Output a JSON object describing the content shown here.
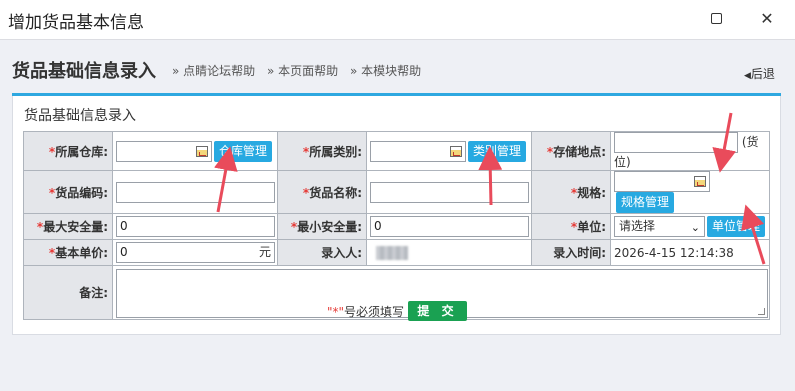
{
  "window": {
    "title": "增加货品基本信息"
  },
  "header": {
    "title": "货品基础信息录入",
    "help_links": [
      "» 点睛论坛帮助",
      "» 本页面帮助",
      "» 本模块帮助"
    ],
    "back_label": "后退"
  },
  "form": {
    "section_title": "货品基础信息录入",
    "required_mark": "*",
    "labels": {
      "warehouse": "所属仓库:",
      "category": "所属类别:",
      "location": "存储地点:",
      "code": "货品编码:",
      "name": "货品名称:",
      "spec": "规格:",
      "max_stock": "最大安全量:",
      "min_stock": "最小安全量:",
      "unit": "单位:",
      "unit_price": "基本单价:",
      "entered_by": "录入人:",
      "entry_time": "录入时间:",
      "remarks": "备注:"
    },
    "values": {
      "warehouse": "",
      "category": "",
      "location": "",
      "location_suffix": "(货位)",
      "code": "",
      "name": "",
      "spec": "",
      "max_stock": "0",
      "min_stock": "0",
      "unit_selected": "请选择",
      "unit_price": "0",
      "unit_price_suffix": "元",
      "entry_time": "2026-4-15 12:14:38",
      "remarks": ""
    },
    "buttons": {
      "warehouse_manage": "仓库管理",
      "category_manage": "类别管理",
      "spec_manage": "规格管理",
      "unit_manage": "单位管理"
    }
  },
  "footer": {
    "hint_star": "\"*\"",
    "hint_text": "号必须填写",
    "submit_label": "提 交"
  },
  "colors": {
    "accent_blue": "#27a9e1",
    "header_line": "#2ea8e0",
    "required_red": "#e53935",
    "submit_green": "#1aa152",
    "annotation_arrow": "#e94b5b"
  }
}
